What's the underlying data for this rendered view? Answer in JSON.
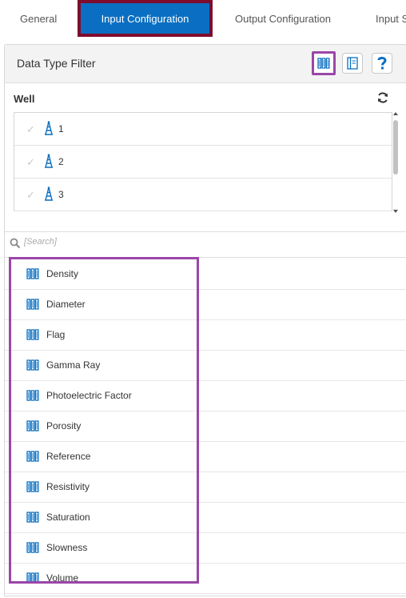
{
  "tabs": [
    {
      "label": "General"
    },
    {
      "label": "Input Configuration"
    },
    {
      "label": "Output Configuration"
    },
    {
      "label": "Input S"
    }
  ],
  "panel": {
    "title": "Data Type Filter",
    "header_buttons": [
      "data-type-icon",
      "log-icon",
      "help-icon"
    ]
  },
  "well": {
    "label": "Well",
    "items": [
      {
        "name": "1"
      },
      {
        "name": "2"
      },
      {
        "name": "3"
      }
    ]
  },
  "search": {
    "placeholder": "[Search]"
  },
  "data_types": [
    {
      "label": "Density"
    },
    {
      "label": "Diameter"
    },
    {
      "label": "Flag"
    },
    {
      "label": "Gamma Ray"
    },
    {
      "label": "Photoelectric Factor"
    },
    {
      "label": "Porosity"
    },
    {
      "label": "Reference"
    },
    {
      "label": "Resistivity"
    },
    {
      "label": "Saturation"
    },
    {
      "label": "Slowness"
    },
    {
      "label": "Volume"
    }
  ],
  "colors": {
    "accent": "#0a6fc2",
    "tab_highlight": "#7f0b2d",
    "list_highlight": "#9b46a8"
  }
}
